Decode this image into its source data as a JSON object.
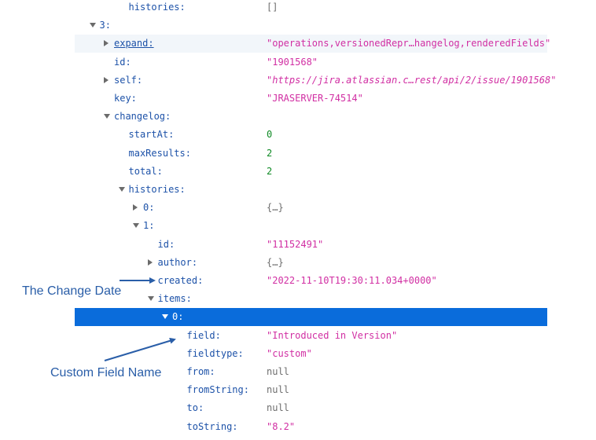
{
  "rows": [
    {
      "key": "histories:",
      "value": "[]",
      "type": "obj",
      "toggle": "none"
    },
    {
      "key": "3:",
      "value": "",
      "type": "none",
      "toggle": "open"
    },
    {
      "key": "expand:",
      "value": "\"operations,versionedRepr…hangelog,renderedFields\"",
      "type": "str",
      "toggle": "closed",
      "link": true
    },
    {
      "key": "id:",
      "value": "\"1901568\"",
      "type": "str",
      "toggle": "none"
    },
    {
      "key": "self:",
      "value": "\"https://jira.atlassian.c…rest/api/2/issue/1901568\"",
      "type": "url",
      "toggle": "closed"
    },
    {
      "key": "key:",
      "value": "\"JRASERVER-74514\"",
      "type": "str",
      "toggle": "none"
    },
    {
      "key": "changelog:",
      "value": "",
      "type": "none",
      "toggle": "open"
    },
    {
      "key": "startAt:",
      "value": "0",
      "type": "num",
      "toggle": "none"
    },
    {
      "key": "maxResults:",
      "value": "2",
      "type": "num",
      "toggle": "none"
    },
    {
      "key": "total:",
      "value": "2",
      "type": "num",
      "toggle": "none"
    },
    {
      "key": "histories:",
      "value": "",
      "type": "none",
      "toggle": "open"
    },
    {
      "key": "0:",
      "value": "{…}",
      "type": "obj",
      "toggle": "closed"
    },
    {
      "key": "1:",
      "value": "",
      "type": "none",
      "toggle": "open"
    },
    {
      "key": "id:",
      "value": "\"11152491\"",
      "type": "str",
      "toggle": "none"
    },
    {
      "key": "author:",
      "value": "{…}",
      "type": "obj",
      "toggle": "closed"
    },
    {
      "key": "created:",
      "value": "\"2022-11-10T19:30:11.034+0000\"",
      "type": "str",
      "toggle": "none"
    },
    {
      "key": "items:",
      "value": "",
      "type": "none",
      "toggle": "open"
    },
    {
      "key": "0:",
      "value": "",
      "type": "none",
      "toggle": "open",
      "selected": true
    },
    {
      "key": "field:",
      "value": "\"Introduced in Version\"",
      "type": "str",
      "toggle": "none"
    },
    {
      "key": "fieldtype:",
      "value": "\"custom\"",
      "type": "str",
      "toggle": "none"
    },
    {
      "key": "from:",
      "value": "null",
      "type": "nul",
      "toggle": "none"
    },
    {
      "key": "fromString:",
      "value": "null",
      "type": "nul",
      "toggle": "none"
    },
    {
      "key": "to:",
      "value": "null",
      "type": "nul",
      "toggle": "none"
    },
    {
      "key": "toString:",
      "value": "\"8.2\"",
      "type": "str",
      "toggle": "none"
    }
  ],
  "annotations": {
    "change_date": "The Change Date",
    "custom_field_name": "Custom Field Name",
    "color": "#2a5ea8"
  },
  "colors": {
    "key": "#1d52a8",
    "string": "#d12fa3",
    "number": "#0f8a25",
    "null": "#6e6e6e",
    "selected_row": "#0a6cdb",
    "alt_row": "#f2f6fa"
  }
}
